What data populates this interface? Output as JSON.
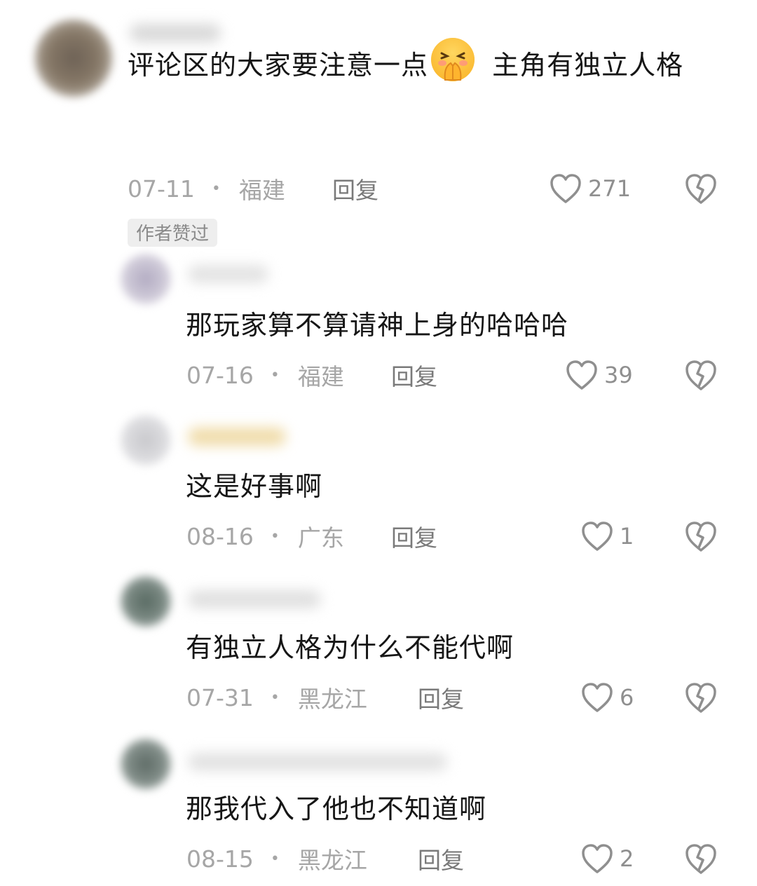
{
  "comments": [
    {
      "text_before": "评论区的大家要注意一点",
      "emoji": "pleading-hands-emoji",
      "text_after": " 主角有独立人格",
      "date": "07-11",
      "location": "福建",
      "reply_label": "回复",
      "likes": "271",
      "badge": "作者赞过"
    }
  ],
  "replies": [
    {
      "text": "那玩家算不算请神上身的哈哈哈",
      "date": "07-16",
      "location": "福建",
      "reply_label": "回复",
      "likes": "39"
    },
    {
      "text": "这是好事啊",
      "date": "08-16",
      "location": "广东",
      "reply_label": "回复",
      "likes": "1"
    },
    {
      "text": "有独立人格为什么不能代啊",
      "date": "07-31",
      "location": "黑龙江",
      "reply_label": "回复",
      "likes": "6"
    },
    {
      "text": "那我代入了他也不知道啊",
      "date": "08-15",
      "location": "黑龙江",
      "reply_label": "回复",
      "likes": "2"
    }
  ],
  "icons": {
    "like": "heart-outline-icon",
    "dislike": "broken-heart-icon"
  },
  "colors": {
    "text": "#161616",
    "meta": "#a6a6a6",
    "reply": "#7a7a7a",
    "icon": "#8f8f8f"
  }
}
